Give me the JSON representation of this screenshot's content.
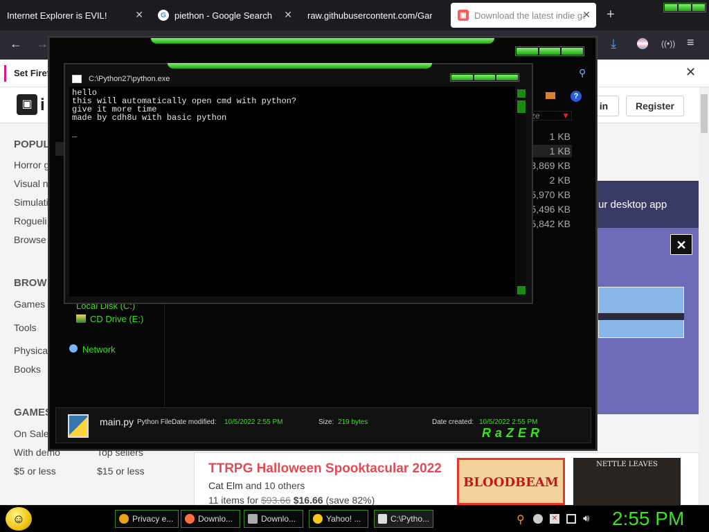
{
  "tabs": [
    {
      "label": "Internet Explorer is EVIL!",
      "icon": "page-icon"
    },
    {
      "label": "piethon - Google Search",
      "icon": "google-icon"
    },
    {
      "label": "raw.githubusercontent.com/Garb...",
      "icon": "page-icon"
    },
    {
      "label": "Download the latest indie gam",
      "icon": "itch-icon",
      "active": true
    }
  ],
  "infobar": {
    "text": "Set Firef"
  },
  "itch": {
    "login": "in",
    "register": "Register",
    "sidebar": {
      "popular_heading": "POPUL",
      "popular": [
        "Horror g",
        "Visual n",
        "Simulati",
        "Rogueli",
        "Browse"
      ],
      "browse_heading": "BROW",
      "browse": [
        "Games",
        "Tools",
        "Physica",
        "Books"
      ],
      "games_heading": "GAMES",
      "games_left": [
        "On Sale",
        "With demo",
        "$5 or less"
      ],
      "games_right": [
        "Top sellers",
        "$15 or less"
      ]
    },
    "promo_text": "ur desktop app",
    "bundle": {
      "title": "TTRPG Halloween Spooktacular 2022",
      "author": "Cat Elm",
      "author_suffix": "and 10 others",
      "items_prefix": "11 items for",
      "old_price": "$93.66",
      "new_price": "$16.66",
      "save": "(save 82%)"
    },
    "cover1": "BLOODBEAM",
    "cover2": "NETTLE LEAVES"
  },
  "explorer": {
    "sizes": [
      "1 KB",
      "1 KB",
      "3,869 KB",
      "2 KB",
      "5,970 KB",
      "5,496 KB",
      "5,842 KB"
    ],
    "size_header": "ze",
    "tree": [
      "Local Disk (C:)",
      "CD Drive (E:)",
      "Network"
    ],
    "details": {
      "filename": "main.py",
      "filetype": "Python File",
      "modified_label": "Date modified:",
      "modified_value": "10/5/2022 2:55 PM",
      "size_label": "Size:",
      "size_value": "219 bytes",
      "created_label": "Date created:",
      "created_value": "10/5/2022 2:55 PM"
    },
    "brand": "RaZER"
  },
  "cmd": {
    "title": "C:\\Python27\\python.exe",
    "output": "hello\nthis will automatically open cmd with python?\ngive it more time\nmade by cdh8u with basic python\n\n_"
  },
  "taskbar": {
    "buttons": [
      {
        "label": "Privacy e...",
        "icon": "chrome-icon",
        "color": "#e9a21b"
      },
      {
        "label": "Downlo...",
        "icon": "firefox-icon",
        "color": "#ff7139"
      },
      {
        "label": "Downlo...",
        "icon": "page-icon",
        "color": "#aaaaaa"
      },
      {
        "label": "Yahoo! ...",
        "icon": "smiley-icon",
        "color": "#f6c71a"
      },
      {
        "label": "C:\\Pytho...",
        "icon": "console-icon",
        "color": "#dddddd",
        "active": true
      }
    ],
    "clock": "2:55 PM"
  },
  "colors": {
    "accent": "#39e51a",
    "itch_red": "#fa5c5c"
  }
}
